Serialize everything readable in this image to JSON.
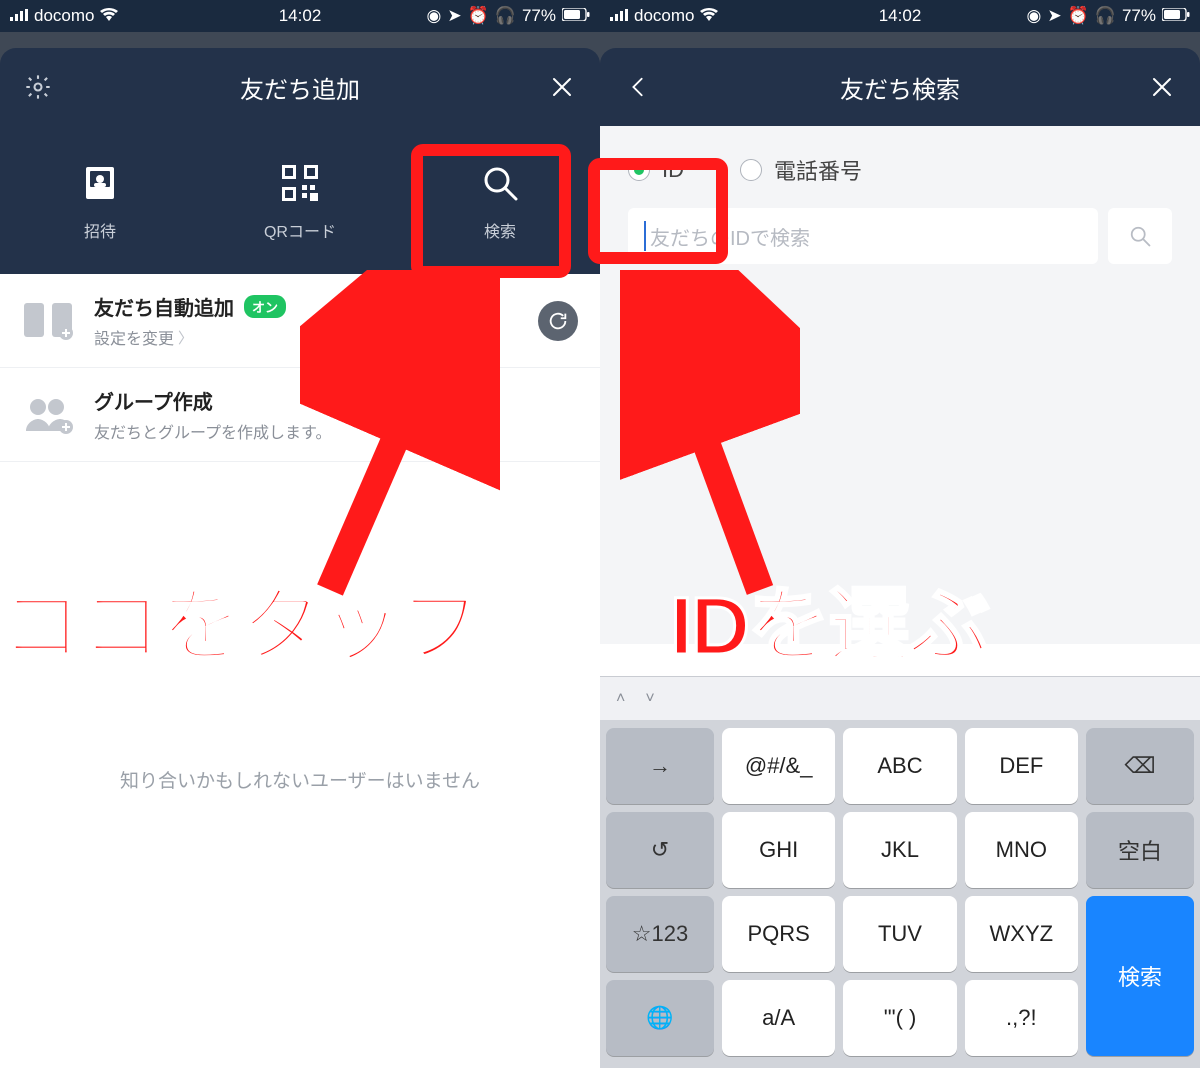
{
  "status": {
    "carrier": "docomo",
    "time": "14:02",
    "battery": "77%"
  },
  "screen1": {
    "header_title": "友だち追加",
    "toolbar": {
      "invite": "招待",
      "qrcode": "QRコード",
      "search": "検索"
    },
    "auto_add": {
      "title": "友だち自動追加",
      "badge": "オン",
      "subtitle": "設定を変更"
    },
    "group": {
      "title": "グループ作成",
      "subtitle": "友だちとグループを作成します。"
    },
    "empty": "知り合いかもしれないユーザーはいません"
  },
  "screen2": {
    "header_title": "友だち検索",
    "radio_id": "ID",
    "radio_phone": "電話番号",
    "placeholder": "友だちのIDで検索"
  },
  "keyboard": {
    "row1": [
      "→",
      "@#/&_",
      "ABC",
      "DEF",
      "⌫"
    ],
    "row2": [
      "↺",
      "GHI",
      "JKL",
      "MNO",
      "空白"
    ],
    "row3": [
      "☆123",
      "PQRS",
      "TUV",
      "WXYZ"
    ],
    "row4_globe": "🌐",
    "row4_shift": "a/A",
    "row4_sym1": "'\"( )",
    "row4_sym2": ".,?!",
    "search_key": "検索"
  },
  "annotation": {
    "tap_here": "ココをタップ",
    "choose_id": "IDを選ぶ"
  }
}
